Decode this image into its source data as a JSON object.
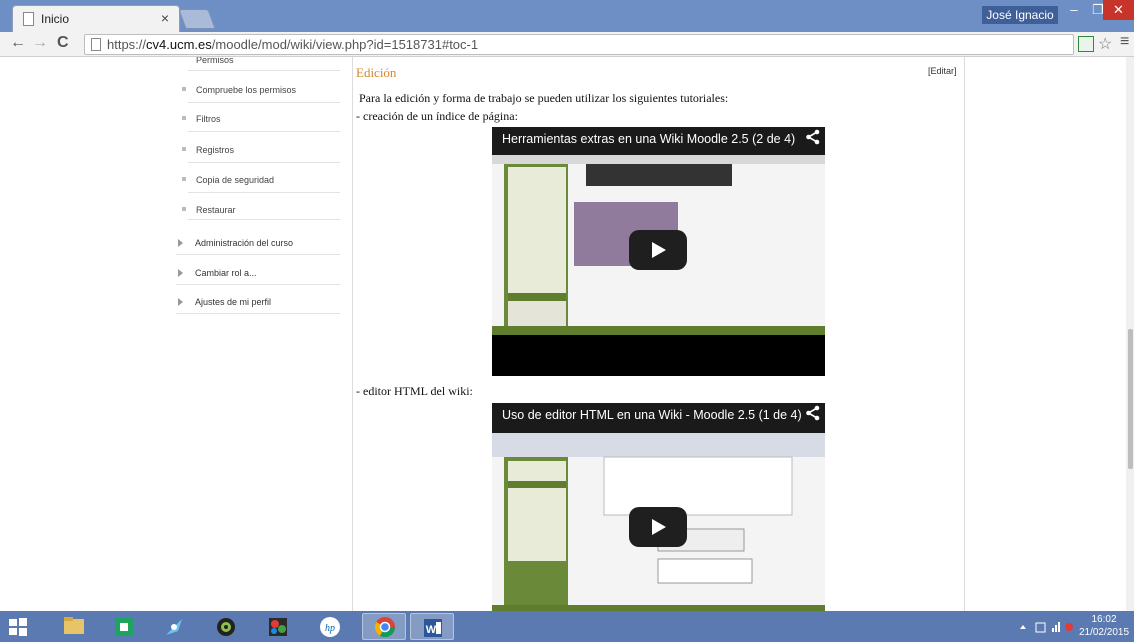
{
  "browser": {
    "tab_title": "Inicio",
    "tab_close": "×",
    "user_name": "José Ignacio",
    "url_prefix": "https://",
    "url_host": "cv4.ucm.es",
    "url_path": "/moodle/mod/wiki/view.php?id=1518731#toc-1"
  },
  "sidebar": {
    "sub_items": [
      "Permisos",
      "Compruebe los permisos",
      "Filtros",
      "Registros",
      "Copia de seguridad",
      "Restaurar"
    ],
    "main_items": [
      "Administración del curso",
      "Cambiar rol a...",
      "Ajustes de mi perfil"
    ]
  },
  "content": {
    "section_title": "Edición",
    "edit_link": "[Editar]",
    "intro": "Para la edición y forma de trabajo se pueden utilizar los siguientes tutoriales:",
    "item1": "- creación de un índice de página:",
    "item2": "- editor HTML del wiki:",
    "video1_title": "Herramientas extras en una Wiki Moodle 2.5 (2 de 4)",
    "video2_title": "Uso de editor HTML en una Wiki - Moodle 2.5 (1 de 4)"
  },
  "taskbar": {
    "time": "16:02",
    "date": "21/02/2015"
  },
  "colors": {
    "accent": "#d6882b",
    "titlebar": "#6d8fc6",
    "taskbar": "#5b7ab1"
  }
}
